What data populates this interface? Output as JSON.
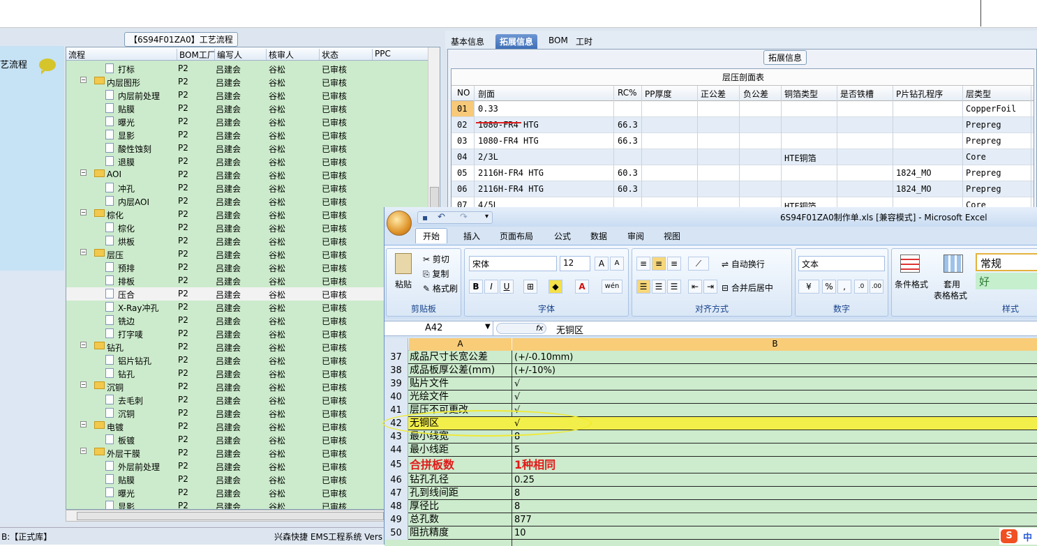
{
  "tree_panel": {
    "title": "【6S94F01ZA0】工艺流程",
    "left_label": "艺流程",
    "columns": [
      "流程",
      "BOM工厂",
      "编写人",
      "核审人",
      "状态",
      "PPC"
    ],
    "rows": [
      {
        "name": "打标",
        "type": "doc",
        "level": 2,
        "bom": "P2",
        "writer": "吕建会",
        "reviewer": "谷松",
        "status": "已审核"
      },
      {
        "name": "内层图形",
        "type": "folder",
        "level": 1,
        "bom": "P2",
        "writer": "吕建会",
        "reviewer": "谷松",
        "status": "已审核"
      },
      {
        "name": "内层前处理",
        "type": "doc",
        "level": 2,
        "bom": "P2",
        "writer": "吕建会",
        "reviewer": "谷松",
        "status": "已审核"
      },
      {
        "name": "贴膜",
        "type": "doc",
        "level": 2,
        "bom": "P2",
        "writer": "吕建会",
        "reviewer": "谷松",
        "status": "已审核"
      },
      {
        "name": "曝光",
        "type": "doc",
        "level": 2,
        "bom": "P2",
        "writer": "吕建会",
        "reviewer": "谷松",
        "status": "已审核"
      },
      {
        "name": "显影",
        "type": "doc",
        "level": 2,
        "bom": "P2",
        "writer": "吕建会",
        "reviewer": "谷松",
        "status": "已审核"
      },
      {
        "name": "酸性蚀刻",
        "type": "doc",
        "level": 2,
        "bom": "P2",
        "writer": "吕建会",
        "reviewer": "谷松",
        "status": "已审核"
      },
      {
        "name": "退膜",
        "type": "doc",
        "level": 2,
        "bom": "P2",
        "writer": "吕建会",
        "reviewer": "谷松",
        "status": "已审核"
      },
      {
        "name": "AOI",
        "type": "folder",
        "level": 1,
        "bom": "P2",
        "writer": "吕建会",
        "reviewer": "谷松",
        "status": "已审核"
      },
      {
        "name": "冲孔",
        "type": "doc",
        "level": 2,
        "bom": "P2",
        "writer": "吕建会",
        "reviewer": "谷松",
        "status": "已审核"
      },
      {
        "name": "内层AOI",
        "type": "doc",
        "level": 2,
        "bom": "P2",
        "writer": "吕建会",
        "reviewer": "谷松",
        "status": "已审核"
      },
      {
        "name": "棕化",
        "type": "folder",
        "level": 1,
        "bom": "P2",
        "writer": "吕建会",
        "reviewer": "谷松",
        "status": "已审核"
      },
      {
        "name": "棕化",
        "type": "doc",
        "level": 2,
        "bom": "P2",
        "writer": "吕建会",
        "reviewer": "谷松",
        "status": "已审核"
      },
      {
        "name": "烘板",
        "type": "doc",
        "level": 2,
        "bom": "P2",
        "writer": "吕建会",
        "reviewer": "谷松",
        "status": "已审核"
      },
      {
        "name": "层压",
        "type": "folder",
        "level": 1,
        "bom": "P2",
        "writer": "吕建会",
        "reviewer": "谷松",
        "status": "已审核"
      },
      {
        "name": "预排",
        "type": "doc",
        "level": 2,
        "bom": "P2",
        "writer": "吕建会",
        "reviewer": "谷松",
        "status": "已审核"
      },
      {
        "name": "排板",
        "type": "doc",
        "level": 2,
        "bom": "P2",
        "writer": "吕建会",
        "reviewer": "谷松",
        "status": "已审核"
      },
      {
        "name": "压合",
        "type": "doc",
        "level": 2,
        "bom": "P2",
        "writer": "吕建会",
        "reviewer": "谷松",
        "status": "已审核",
        "selected": true
      },
      {
        "name": "X-Ray冲孔",
        "type": "doc",
        "level": 2,
        "bom": "P2",
        "writer": "吕建会",
        "reviewer": "谷松",
        "status": "已审核"
      },
      {
        "name": "铣边",
        "type": "doc",
        "level": 2,
        "bom": "P2",
        "writer": "吕建会",
        "reviewer": "谷松",
        "status": "已审核"
      },
      {
        "name": "打字唛",
        "type": "doc",
        "level": 2,
        "bom": "P2",
        "writer": "吕建会",
        "reviewer": "谷松",
        "status": "已审核"
      },
      {
        "name": "钻孔",
        "type": "folder",
        "level": 1,
        "bom": "P2",
        "writer": "吕建会",
        "reviewer": "谷松",
        "status": "已审核"
      },
      {
        "name": "铝片钻孔",
        "type": "doc",
        "level": 2,
        "bom": "P2",
        "writer": "吕建会",
        "reviewer": "谷松",
        "status": "已审核"
      },
      {
        "name": "钻孔",
        "type": "doc",
        "level": 2,
        "bom": "P2",
        "writer": "吕建会",
        "reviewer": "谷松",
        "status": "已审核"
      },
      {
        "name": "沉铜",
        "type": "folder",
        "level": 1,
        "bom": "P2",
        "writer": "吕建会",
        "reviewer": "谷松",
        "status": "已审核"
      },
      {
        "name": "去毛刺",
        "type": "doc",
        "level": 2,
        "bom": "P2",
        "writer": "吕建会",
        "reviewer": "谷松",
        "status": "已审核"
      },
      {
        "name": "沉铜",
        "type": "doc",
        "level": 2,
        "bom": "P2",
        "writer": "吕建会",
        "reviewer": "谷松",
        "status": "已审核"
      },
      {
        "name": "电镀",
        "type": "folder",
        "level": 1,
        "bom": "P2",
        "writer": "吕建会",
        "reviewer": "谷松",
        "status": "已审核"
      },
      {
        "name": "板镀",
        "type": "doc",
        "level": 2,
        "bom": "P2",
        "writer": "吕建会",
        "reviewer": "谷松",
        "status": "已审核"
      },
      {
        "name": "外层干膜",
        "type": "folder",
        "level": 1,
        "bom": "P2",
        "writer": "吕建会",
        "reviewer": "谷松",
        "status": "已审核"
      },
      {
        "name": "外层前处理",
        "type": "doc",
        "level": 2,
        "bom": "P2",
        "writer": "吕建会",
        "reviewer": "谷松",
        "status": "已审核"
      },
      {
        "name": "贴膜",
        "type": "doc",
        "level": 2,
        "bom": "P2",
        "writer": "吕建会",
        "reviewer": "谷松",
        "status": "已审核"
      },
      {
        "name": "曝光",
        "type": "doc",
        "level": 2,
        "bom": "P2",
        "writer": "吕建会",
        "reviewer": "谷松",
        "status": "已审核"
      },
      {
        "name": "显影",
        "type": "doc",
        "level": 2,
        "bom": "P2",
        "writer": "吕建会",
        "reviewer": "谷松",
        "status": "已审核"
      }
    ]
  },
  "status_bar": {
    "left": "B:【正式库】",
    "right": "兴森快捷 EMS工程系统 Vers"
  },
  "right_tabs": [
    "基本信息",
    "拓展信息",
    "BOM",
    "工时"
  ],
  "active_right_tab": 1,
  "ext_title": "拓展信息",
  "layer_table": {
    "title": "层压剖面表",
    "columns": [
      "NO",
      "剖面",
      "RC%",
      "PP厚度",
      "正公差",
      "负公差",
      "铜箔类型",
      "是否铁槽",
      "P片钻孔程序",
      "层类型"
    ],
    "rows": [
      [
        "01",
        "0.33",
        "",
        "",
        "",
        "",
        "",
        "",
        "",
        "CopperFoil"
      ],
      [
        "02",
        "1080-FR4 HTG",
        "66.3",
        "",
        "",
        "",
        "",
        "",
        "",
        "Prepreg"
      ],
      [
        "03",
        "1080-FR4 HTG",
        "66.3",
        "",
        "",
        "",
        "",
        "",
        "",
        "Prepreg"
      ],
      [
        "04",
        "2/3L",
        "",
        "",
        "",
        "",
        "HTE铜箔",
        "",
        "",
        "Core"
      ],
      [
        "05",
        "2116H-FR4 HTG",
        "60.3",
        "",
        "",
        "",
        "",
        "",
        "1824_MO",
        "Prepreg"
      ],
      [
        "06",
        "2116H-FR4 HTG",
        "60.3",
        "",
        "",
        "",
        "",
        "",
        "1824_MO",
        "Prepreg"
      ],
      [
        "07",
        "4/5L",
        "",
        "",
        "",
        "",
        "HTE铜箔",
        "",
        "",
        "Core"
      ]
    ]
  },
  "excel": {
    "title": "6S94F01ZA0制作单.xls  [兼容模式] - Microsoft Excel",
    "tabs": [
      "开始",
      "插入",
      "页面布局",
      "公式",
      "数据",
      "审阅",
      "视图"
    ],
    "active_tab": 0,
    "clipboard": {
      "paste": "粘贴",
      "cut": "剪切",
      "copy": "复制",
      "format_painter": "格式刷",
      "label": "剪贴板"
    },
    "font": {
      "name": "宋体",
      "size": "12",
      "label": "字体",
      "bold": "B",
      "italic": "I",
      "underline": "U"
    },
    "align": {
      "wrap": "自动换行",
      "merge": "合并后居中",
      "label": "对齐方式"
    },
    "number": {
      "format": "文本",
      "label": "数字",
      "percent": "%",
      "comma": ","
    },
    "styles": {
      "cond": "条件格式",
      "table_line1": "套用",
      "table_line2": "表格格式",
      "normal": "常规",
      "good": "好",
      "label": "样式"
    },
    "name_box": "A42",
    "fx": "fx",
    "formula": "无铜区",
    "col_a": "A",
    "col_b": "B",
    "rows": [
      {
        "n": "37",
        "a": "成品尺寸长宽公差",
        "b": "(+/-0.10mm)"
      },
      {
        "n": "38",
        "a": "成品板厚公差(mm)",
        "b": "(+/-10%)"
      },
      {
        "n": "39",
        "a": "贴片文件",
        "b": "√"
      },
      {
        "n": "40",
        "a": "光绘文件",
        "b": "√"
      },
      {
        "n": "41",
        "a": "层压不可更改",
        "b": "√"
      },
      {
        "n": "42",
        "a": "无铜区",
        "b": "√",
        "highlight": true
      },
      {
        "n": "43",
        "a": "最小线宽",
        "b": "8"
      },
      {
        "n": "44",
        "a": "最小线距",
        "b": "5"
      },
      {
        "n": "45",
        "a": "合拼板数",
        "b": "1种相同",
        "big": true
      },
      {
        "n": "46",
        "a": "钻孔孔径",
        "b": "0.25"
      },
      {
        "n": "47",
        "a": "孔到线间距",
        "b": "8"
      },
      {
        "n": "48",
        "a": "厚径比",
        "b": "8"
      },
      {
        "n": "49",
        "a": "总孔数",
        "b": "877"
      },
      {
        "n": "50",
        "a": "阻抗精度",
        "b": "10"
      }
    ]
  },
  "ime": {
    "s": "S",
    "lang": "中"
  }
}
